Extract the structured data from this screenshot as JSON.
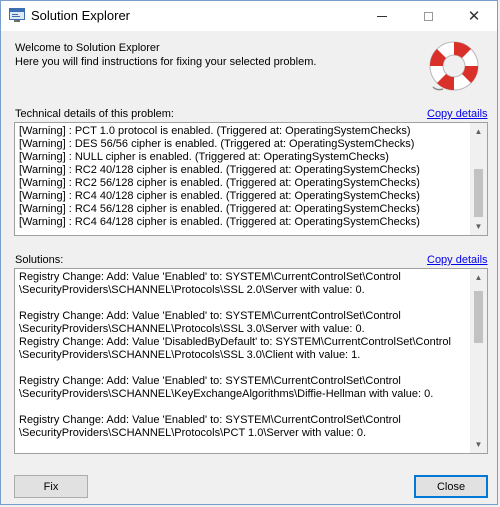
{
  "window": {
    "title": "Solution Explorer",
    "minimize_glyph": "minimize-icon",
    "maximize_glyph": "maximize-icon",
    "close_glyph": "✕"
  },
  "welcome": {
    "heading": "Welcome to Solution Explorer",
    "subtext": "Here you will find instructions for fixing your selected problem."
  },
  "technical": {
    "label": "Technical details of this problem:",
    "copy_label": "Copy details",
    "lines": [
      "[Warning] : PCT 1.0 protocol is enabled. (Triggered at: OperatingSystemChecks)",
      "[Warning] : DES 56/56 cipher is enabled. (Triggered at: OperatingSystemChecks)",
      "[Warning] : NULL cipher is enabled. (Triggered at: OperatingSystemChecks)",
      "[Warning] : RC2 40/128 cipher is enabled. (Triggered at: OperatingSystemChecks)",
      "[Warning] : RC2 56/128 cipher is enabled. (Triggered at: OperatingSystemChecks)",
      "[Warning] : RC4 40/128 cipher is enabled. (Triggered at: OperatingSystemChecks)",
      "[Warning] : RC4 56/128 cipher is enabled. (Triggered at: OperatingSystemChecks)",
      "[Warning] : RC4 64/128 cipher is enabled. (Triggered at: OperatingSystemChecks)"
    ]
  },
  "solutions": {
    "label": "Solutions:",
    "copy_label": "Copy details",
    "lines": [
      "Registry Change: Add: Value 'Enabled' to: SYSTEM\\CurrentControlSet\\Control",
      "\\SecurityProviders\\SCHANNEL\\Protocols\\SSL 2.0\\Server with value: 0.",
      "",
      "Registry Change: Add: Value 'Enabled' to: SYSTEM\\CurrentControlSet\\Control",
      "\\SecurityProviders\\SCHANNEL\\Protocols\\SSL 3.0\\Server with value: 0.",
      "Registry Change: Add: Value 'DisabledByDefault' to: SYSTEM\\CurrentControlSet\\Control",
      "\\SecurityProviders\\SCHANNEL\\Protocols\\SSL 3.0\\Client with value: 1.",
      "",
      "Registry Change: Add: Value 'Enabled' to: SYSTEM\\CurrentControlSet\\Control",
      "\\SecurityProviders\\SCHANNEL\\KeyExchangeAlgorithms\\Diffie-Hellman with value: 0.",
      "",
      "Registry Change: Add: Value 'Enabled' to: SYSTEM\\CurrentControlSet\\Control",
      "\\SecurityProviders\\SCHANNEL\\Protocols\\PCT 1.0\\Server with value: 0."
    ]
  },
  "buttons": {
    "fix": "Fix",
    "close": "Close"
  },
  "colors": {
    "link": "#0000ee",
    "default_button_border": "#0078d7",
    "lifebuoy_red": "#d9302a"
  },
  "icons": {
    "app": "app-window-icon",
    "help": "lifebuoy-icon"
  }
}
